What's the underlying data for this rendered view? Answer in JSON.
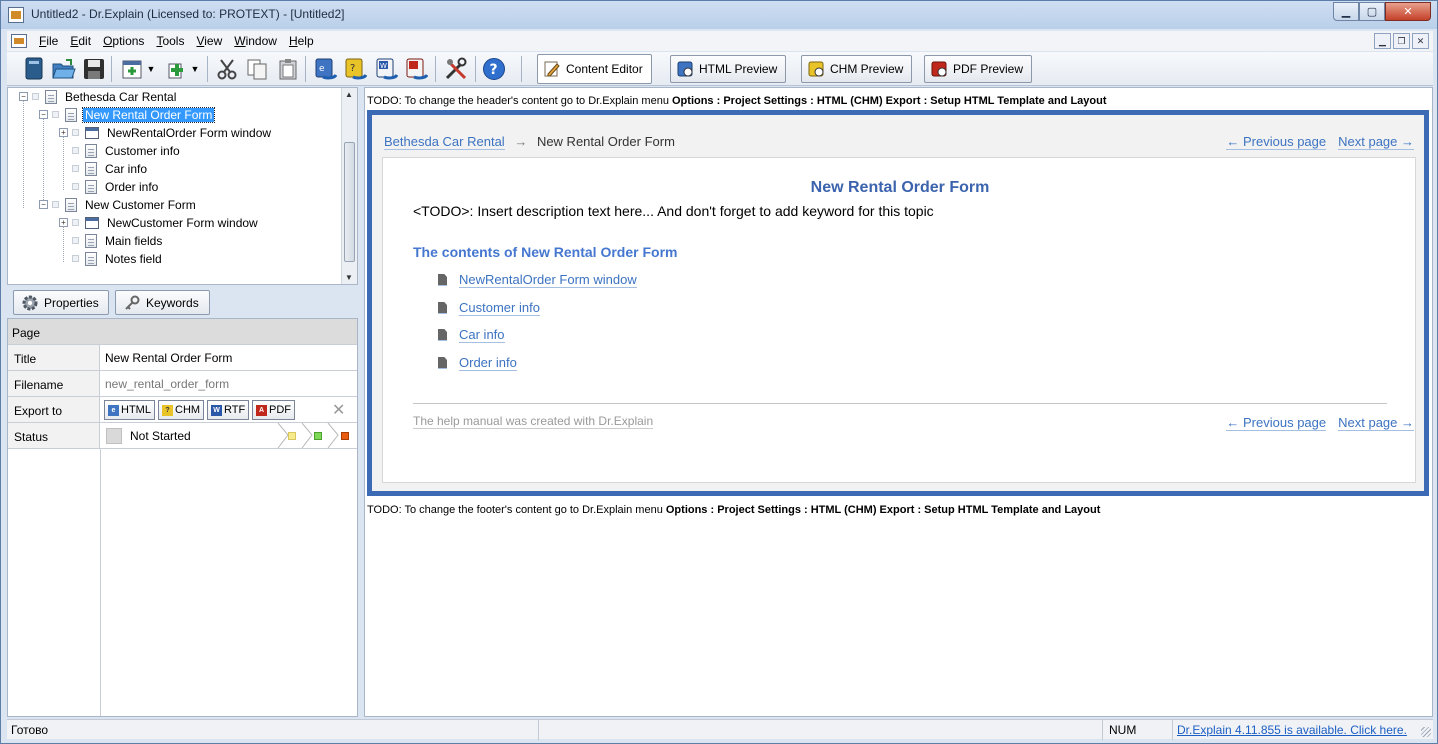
{
  "window": {
    "title": "Untitled2 - Dr.Explain (Licensed to: PROTEXT) - [Untitled2]"
  },
  "menu": [
    {
      "label": "File",
      "u": "F",
      "rest": "ile"
    },
    {
      "label": "Edit",
      "u": "E",
      "rest": "dit"
    },
    {
      "label": "Options",
      "u": "O",
      "rest": "ptions"
    },
    {
      "label": "Tools",
      "u": "T",
      "rest": "ools"
    },
    {
      "label": "View",
      "u": "V",
      "rest": "iew"
    },
    {
      "label": "Window",
      "u": "W",
      "rest": "indow"
    },
    {
      "label": "Help",
      "u": "H",
      "rest": "elp"
    }
  ],
  "toolbar": {
    "content_editor": "Content Editor",
    "html_preview": "HTML Preview",
    "chm_preview": "CHM Preview",
    "pdf_preview": "PDF Preview"
  },
  "tree": {
    "root": "Bethesda Car Rental",
    "n1": "New Rental Order Form",
    "n1a": "NewRentalOrder Form window",
    "n1b": "Customer info",
    "n1c": "Car info",
    "n1d": "Order info",
    "n2": "New Customer Form",
    "n2a": "NewCustomer Form window",
    "n2b": "Main fields",
    "n2c": "Notes field"
  },
  "tabs": {
    "properties": "Properties",
    "keywords": "Keywords"
  },
  "props": {
    "header": "Page",
    "title_key": "Title",
    "title_val": "New Rental Order Form",
    "filename_key": "Filename",
    "filename_val": "new_rental_order_form",
    "export_key": "Export to",
    "export": [
      "HTML",
      "CHM",
      "RTF",
      "PDF"
    ],
    "status_key": "Status",
    "status_val": "Not Started"
  },
  "preview": {
    "header_note_a": "TODO: To change the header's content go to Dr.Explain menu ",
    "header_note_b": "Options : Project Settings : HTML (CHM) Export : Setup HTML Template and Layout",
    "footer_note_a": "TODO: To change the footer's content go to Dr.Explain menu ",
    "footer_note_b": "Options : Project Settings : HTML (CHM) Export : Setup HTML Template and Layout",
    "crumb_root": "Bethesda Car Rental",
    "crumb_arrow": "→",
    "crumb_current": "New Rental Order Form",
    "prev": "← Previous page",
    "next": "Next page →",
    "title": "New Rental Order Form",
    "desc": "<TODO>: Insert description text here... And don't forget to add keyword for this topic",
    "contents_title": "The contents of New Rental Order Form",
    "items": [
      "NewRentalOrder Form window",
      "Customer info",
      "Car info",
      "Order info"
    ],
    "made_with": "The help manual was created with Dr.Explain"
  },
  "statusbar": {
    "left": "Готово",
    "num": "NUM",
    "update": "Dr.Explain 4.11.855 is available. Click here."
  },
  "colors": {
    "accent": "#3d6ab4",
    "link": "#3c73c1",
    "selection": "#3399ff"
  }
}
